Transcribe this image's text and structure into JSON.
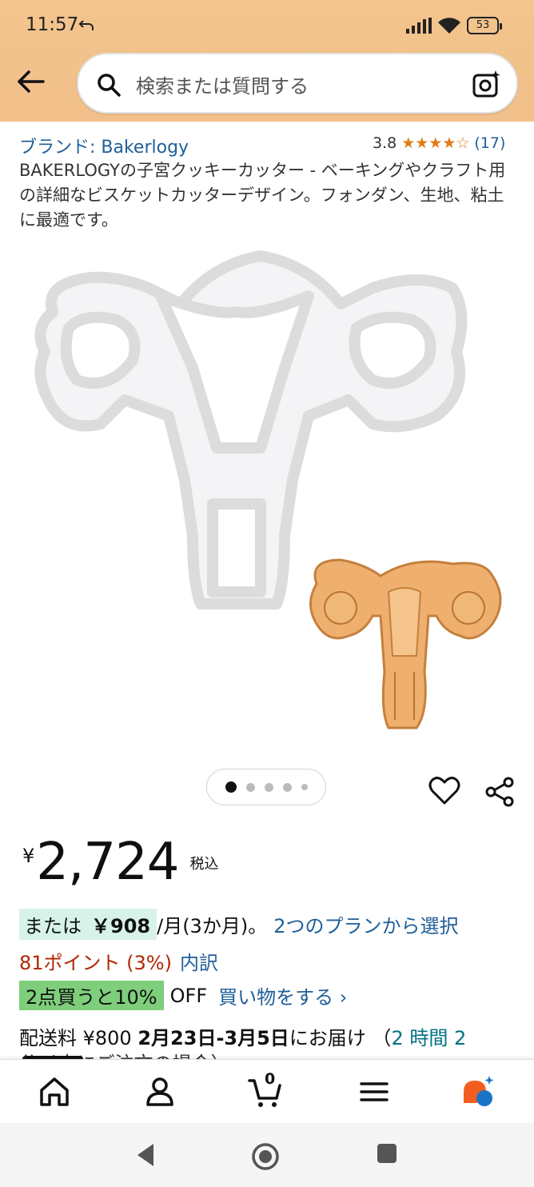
{
  "status_bar": {
    "time": "11:57",
    "battery": "53"
  },
  "search": {
    "placeholder": "検索または質問する"
  },
  "product": {
    "brand": "ブランド: Bakerlogy",
    "rating": "3.8",
    "stars": "★★★★☆",
    "review_count": "(17)",
    "title": "BAKERLOGYの子宮クッキーカッター - ベーキングやクラフト用の詳細なビスケットカッターデザイン。フォンダン、生地、粘土に最適です。"
  },
  "carousel": {
    "total": 5,
    "active": 1
  },
  "price": {
    "currency": "¥",
    "amount": "2,724",
    "tax": "税込"
  },
  "installment": {
    "prefix": "または",
    "amount": "￥908",
    "suffix": "/月(3か月)。",
    "link": "2つのプランから選択"
  },
  "points": {
    "text": "81ポイント (3%)",
    "link": "内訳"
  },
  "promo": {
    "badge": "2点買うと10%",
    "off": "OFF",
    "link": "買い物をする ›"
  },
  "delivery": {
    "prefix": "配送料 ¥800 ",
    "dates": "2月23日-3月5日",
    "suffix": "にお届け （",
    "time": "2 時間 2",
    "cut": "分以内にご注文の場合）"
  },
  "bottom_nav": {
    "cart_count": "0"
  },
  "colors": {
    "header": "#f3c48d",
    "link": "#1f5f99",
    "star": "#e07c16",
    "points": "#b12704",
    "promo": "#7fce7c"
  }
}
